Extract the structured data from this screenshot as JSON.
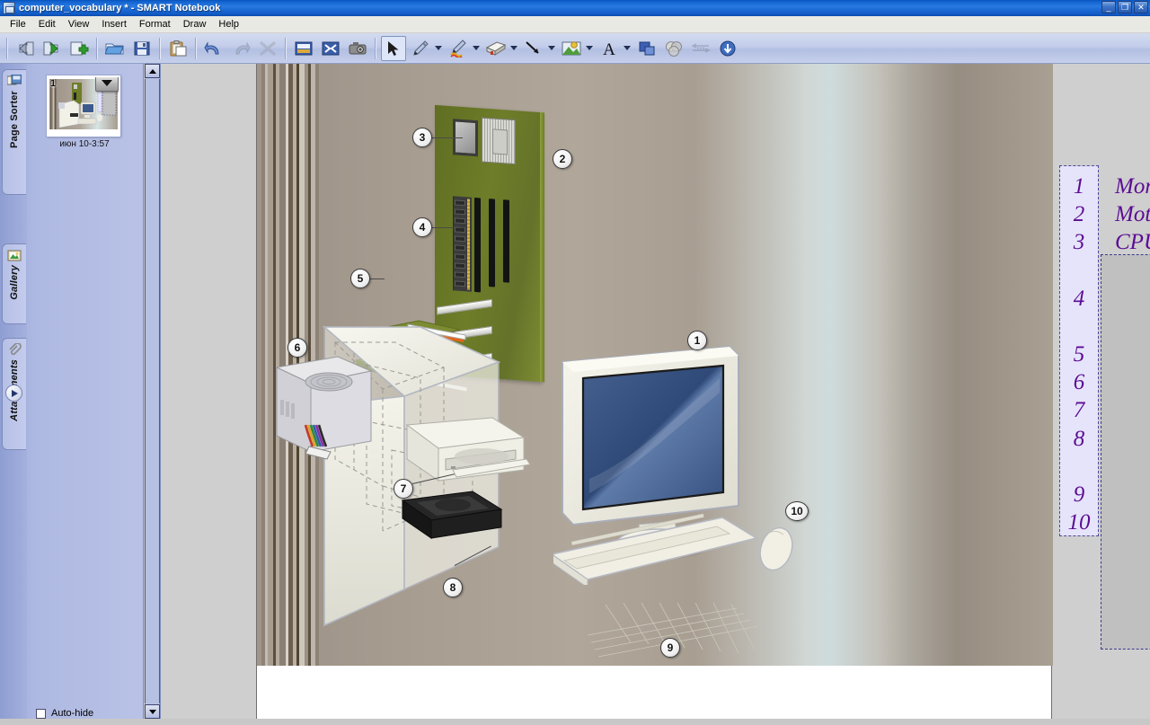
{
  "window": {
    "title": "computer_vocabulary * - SMART Notebook",
    "app_icon": "notebook-icon",
    "minimize": "_",
    "restore": "❐",
    "close": "✕"
  },
  "menu": {
    "items": [
      "File",
      "Edit",
      "View",
      "Insert",
      "Format",
      "Draw",
      "Help"
    ]
  },
  "toolbar": {
    "groups": [
      {
        "buttons": [
          {
            "name": "previous-page-button",
            "icon": "back-arrow-icon",
            "disabled": false
          },
          {
            "name": "next-page-button",
            "icon": "forward-arrow-icon",
            "disabled": false
          },
          {
            "name": "add-page-button",
            "icon": "add-page-icon",
            "disabled": false
          }
        ]
      },
      {
        "buttons": [
          {
            "name": "open-button",
            "icon": "open-folder-icon",
            "disabled": false
          },
          {
            "name": "save-button",
            "icon": "floppy-save-icon",
            "disabled": false
          }
        ]
      },
      {
        "buttons": [
          {
            "name": "paste-button",
            "icon": "clipboard-paste-icon",
            "disabled": false
          }
        ]
      },
      {
        "buttons": [
          {
            "name": "undo-button",
            "icon": "undo-arrow-icon",
            "disabled": false
          },
          {
            "name": "redo-button",
            "icon": "redo-arrow-icon",
            "disabled": true
          },
          {
            "name": "delete-button",
            "icon": "delete-x-icon",
            "disabled": true
          }
        ]
      },
      {
        "buttons": [
          {
            "name": "screen-shade-button",
            "icon": "screen-shade-icon",
            "disabled": false
          },
          {
            "name": "full-screen-button",
            "icon": "full-screen-icon",
            "disabled": false
          },
          {
            "name": "screen-capture-button",
            "icon": "camera-capture-icon",
            "disabled": false
          }
        ]
      },
      {
        "buttons": [
          {
            "name": "select-tool",
            "icon": "cursor-arrow-icon",
            "active": true
          },
          {
            "name": "pen-tool",
            "icon": "pen-icon",
            "has_caret": true
          },
          {
            "name": "creative-pen-tool",
            "icon": "creative-pen-icon",
            "has_caret": true
          },
          {
            "name": "eraser-tool",
            "icon": "eraser-icon",
            "has_caret": true
          },
          {
            "name": "line-tool",
            "icon": "line-icon",
            "has_caret": true
          },
          {
            "name": "shape-tool",
            "icon": "shape-picture-icon",
            "has_caret": true
          },
          {
            "name": "text-tool",
            "icon": "text-a-icon",
            "has_caret": true
          },
          {
            "name": "fill-tool",
            "icon": "fill-squares-icon"
          },
          {
            "name": "transparency-tool",
            "icon": "venn-circles-icon"
          },
          {
            "name": "properties-tool",
            "icon": "line-style-icon",
            "disabled": true
          },
          {
            "name": "move-toolbar-button",
            "icon": "down-arrow-circle-icon"
          }
        ]
      }
    ]
  },
  "sidebar": {
    "tabs": [
      {
        "name": "page-sorter-tab",
        "label": "Page Sorter",
        "icon": "page-sorter-icon",
        "active": true
      },
      {
        "name": "gallery-tab",
        "label": "Gallery",
        "icon": "gallery-picture-icon",
        "active": false
      },
      {
        "name": "attachments-tab",
        "label": "Attachments",
        "icon": "paperclip-icon",
        "active": false
      }
    ],
    "expand_button": "arrow-right-circle-icon",
    "page_thumbnail": {
      "page_number": "1",
      "label": "июн 10-3:57",
      "menu_icon": "chevron-down-icon"
    },
    "autohide": {
      "label": "Auto-hide",
      "checked": false
    }
  },
  "canvas": {
    "illustration": {
      "title": "computer-parts-diagram",
      "callouts": [
        {
          "number": "1",
          "target": "monitor"
        },
        {
          "number": "2",
          "target": "motherboard"
        },
        {
          "number": "3",
          "target": "cpu"
        },
        {
          "number": "4",
          "target": "ram"
        },
        {
          "number": "5",
          "target": "expansion-cards"
        },
        {
          "number": "6",
          "target": "power-supply"
        },
        {
          "number": "7",
          "target": "cd-drive"
        },
        {
          "number": "8",
          "target": "hard-drive"
        },
        {
          "number": "9",
          "target": "keyboard"
        },
        {
          "number": "10",
          "target": "mouse"
        }
      ]
    },
    "number_list": {
      "items": [
        "1",
        "2",
        "3",
        "4",
        "5",
        "6",
        "7",
        "8",
        "9",
        "10"
      ],
      "accent_color": "#5b0d93",
      "background_color": "#e6e4fb"
    },
    "answers": [
      {
        "number": "1",
        "word": "Monitor"
      },
      {
        "number": "2",
        "word": "Motherboard"
      },
      {
        "number": "3",
        "word": "CPU"
      }
    ],
    "selected_rectangle": {
      "name": "answer-area-rectangle",
      "fill_color": "#c0c0c0"
    }
  }
}
